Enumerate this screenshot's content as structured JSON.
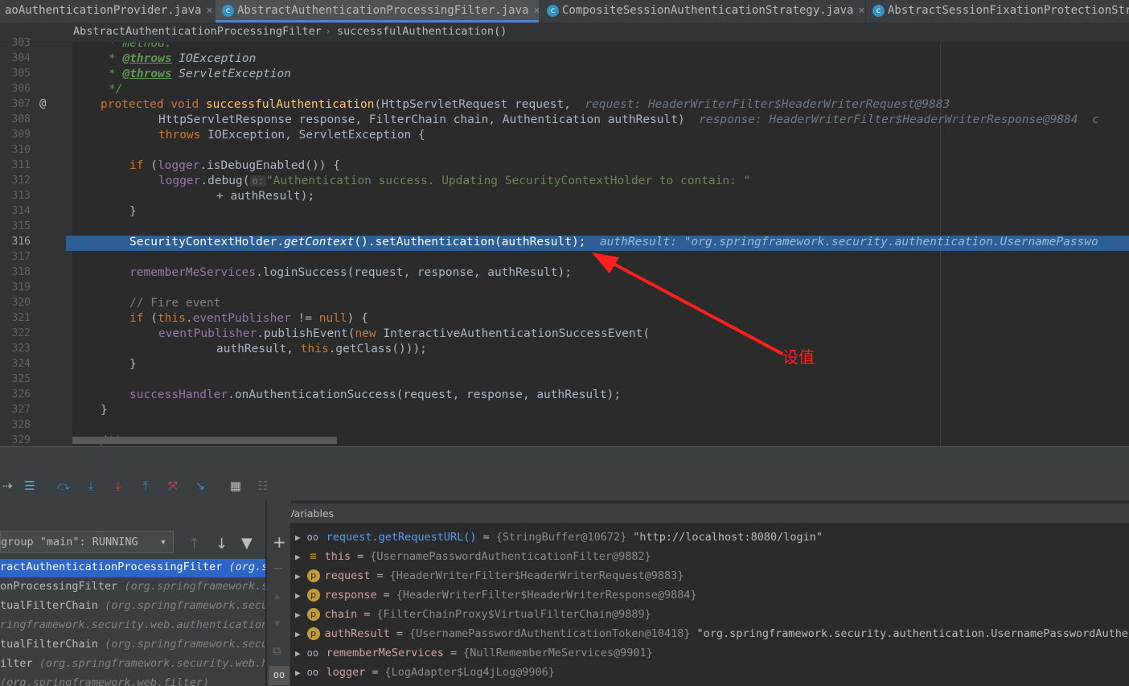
{
  "tabs": [
    {
      "label": "aoAuthenticationProvider.java",
      "active": false
    },
    {
      "label": "AbstractAuthenticationProcessingFilter.java",
      "active": true
    },
    {
      "label": "CompositeSessionAuthenticationStrategy.java",
      "active": false
    },
    {
      "label": "AbstractSessionFixationProtectionStra",
      "active": false
    }
  ],
  "tab_close_glyph": "×",
  "breadcrumb": {
    "class_name": "AbstractAuthenticationProcessingFilter",
    "separator": "›",
    "method": "successfulAuthentication()"
  },
  "editor": {
    "line_numbers": [
      "303",
      "304",
      "305",
      "306",
      "307",
      "308",
      "309",
      "310",
      "311",
      "312",
      "313",
      "314",
      "315",
      "316",
      "317",
      "318",
      "319",
      "320",
      "321",
      "322",
      "323",
      "324",
      "325",
      "326",
      "327",
      "328",
      "329"
    ],
    "current_line": "316",
    "override_marker": "@",
    "code_text": {
      "l303": "method.",
      "l304_tag": "@throws",
      "l304_rest": " IOException",
      "l305_tag": "@throws",
      "l305_rest": " ServletException",
      "l306": "*/",
      "l307_kw": "protected void ",
      "l307_fn": "successfulAuthentication",
      "l307_rest": "(HttpServletRequest request,",
      "l307_inline": "request: HeaderWriterFilter$HeaderWriterRequest@9883",
      "l308": "HttpServletResponse response, FilterChain chain, Authentication authResult)",
      "l308_inline": "response: HeaderWriterFilter$HeaderWriterResponse@9884  c",
      "l309_kw": "throws",
      "l309_rest": " IOException, ServletException {",
      "l311_kw": "if",
      "l311_a": " (",
      "l311_fld": "logger",
      "l311_rest": ".isDebugEnabled()) {",
      "l312_fld": "logger",
      "l312_a": ".debug(",
      "l312_hint": "o:",
      "l312_str": "\"Authentication success. Updating SecurityContextHolder to contain: \"",
      "l313": "+ authResult);",
      "l314": "}",
      "l316_a": "SecurityContextHolder.",
      "l316_it": "getContext",
      "l316_rest": "().setAuthentication(authResult);",
      "l316_inline": "authResult: \"org.springframework.security.authentication.UsernamePasswo",
      "l318_fld": "rememberMeServices",
      "l318_rest": ".loginSuccess(request, response, authResult);",
      "l320": "// Fire event",
      "l321_kw": "if",
      "l321_a": " (",
      "l321_this": "this",
      "l321_dot": ".",
      "l321_fld": "eventPublisher",
      "l321_b": " != ",
      "l321_null": "null",
      "l321_c": ") {",
      "l322_fld": "eventPublisher",
      "l322_a": ".publishEvent(",
      "l322_new": "new",
      "l322_rest": " InteractiveAuthenticationSuccessEvent(",
      "l323_a": "authResult, ",
      "l323_this": "this",
      "l323_rest": ".getClass()));",
      "l324": "}",
      "l326_fld": "successHandler",
      "l326_rest": ".onAuthenticationSuccess(request, response, authResult);",
      "l327": "}",
      "l329": "/**"
    }
  },
  "annotation": {
    "text": "设值",
    "color": "#ff2020"
  },
  "debugger": {
    "thread_selector": "group \"main\": RUNNING",
    "frames": [
      {
        "name": "ractAuthenticationProcessingFilter",
        "pkg": "(org.sp",
        "selected": true
      },
      {
        "name": "onProcessingFilter",
        "pkg": "(org.springframework.se",
        "selected": false
      },
      {
        "name": "tualFilterChain",
        "pkg": "(org.springframework.secu",
        "selected": false
      },
      {
        "name": "",
        "pkg": "ringframework.security.web.authentication",
        "selected": false
      },
      {
        "name": "tualFilterChain",
        "pkg": "(org.springframework.secur",
        "selected": false
      },
      {
        "name": "ilter",
        "pkg": "(org.springframework.security.web.he",
        "selected": false
      },
      {
        "name": "",
        "pkg": "(org.springframework.web.filter)",
        "selected": false
      }
    ],
    "variables_title": "Variables",
    "variables": [
      {
        "icon": "watch",
        "name": "request.getRequestURL()",
        "type": "{StringBuffer@10672}",
        "value": "\"http://localhost:8080/login\""
      },
      {
        "icon": "field",
        "name": "this",
        "type": "{UsernamePasswordAuthenticationFilter@9882}",
        "value": ""
      },
      {
        "icon": "param",
        "name": "request",
        "type": "{HeaderWriterFilter$HeaderWriterRequest@9883}",
        "value": ""
      },
      {
        "icon": "param",
        "name": "response",
        "type": "{HeaderWriterFilter$HeaderWriterResponse@9884}",
        "value": ""
      },
      {
        "icon": "param",
        "name": "chain",
        "type": "{FilterChainProxy$VirtualFilterChain@9889}",
        "value": ""
      },
      {
        "icon": "param",
        "name": "authResult",
        "type": "{UsernamePasswordAuthenticationToken@10418}",
        "value": "\"org.springframework.security.authentication.UsernamePasswordAuther"
      },
      {
        "icon": "watch",
        "name": "rememberMeServices",
        "type": "{NullRememberMeServices@9901}",
        "value": ""
      },
      {
        "icon": "watch",
        "name": "logger",
        "type": "{LogAdapter$Log4jLog@9906}",
        "value": ""
      }
    ],
    "icon_glyphs": {
      "param": "p",
      "watch": "oo",
      "field": "≡",
      "expand": "▶",
      "eq": "="
    }
  },
  "colors": {
    "accent": "#4a88c7",
    "current_line": "#2d5f97",
    "param_badge": "#c59a38"
  }
}
